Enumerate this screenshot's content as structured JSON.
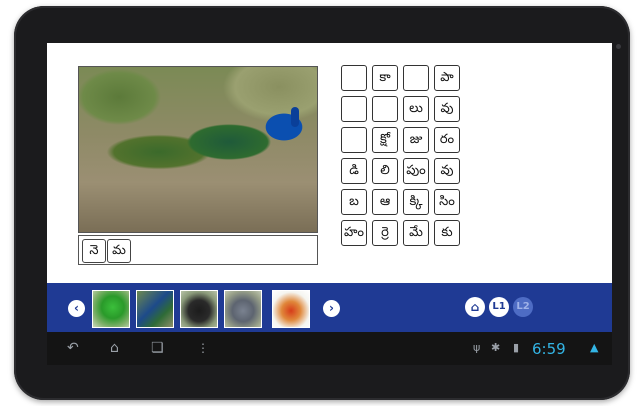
{
  "word_field": {
    "letters": [
      "నె",
      "మ"
    ]
  },
  "letter_grid": [
    [
      "",
      "కా",
      "",
      "పా"
    ],
    [
      "",
      "",
      "లు",
      "వు"
    ],
    [
      "",
      "క్షో",
      "జు",
      "రం"
    ],
    [
      "డి",
      "లి",
      "పుం",
      "వు"
    ],
    [
      "బ",
      "ఆ",
      "క్కి",
      "సిం"
    ],
    [
      "హం",
      "ర్రె",
      "మే",
      "కు"
    ]
  ],
  "thumbnails": [
    {
      "name": "parrot",
      "selected": false
    },
    {
      "name": "peacock",
      "selected": false
    },
    {
      "name": "crow",
      "selected": false
    },
    {
      "name": "pigeon",
      "selected": false
    },
    {
      "name": "rooster",
      "selected": true
    }
  ],
  "nav": {
    "prev_icon": "chevron-left-icon",
    "next_icon": "chevron-right-icon",
    "home_icon": "home-icon",
    "level1_label": "L1",
    "level2_label": "L2"
  },
  "status_bar": {
    "time": "6:59"
  },
  "colors": {
    "bar_blue": "#1f3a94",
    "clock_blue": "#33b5e5",
    "bezel": "#1b1b1d"
  }
}
